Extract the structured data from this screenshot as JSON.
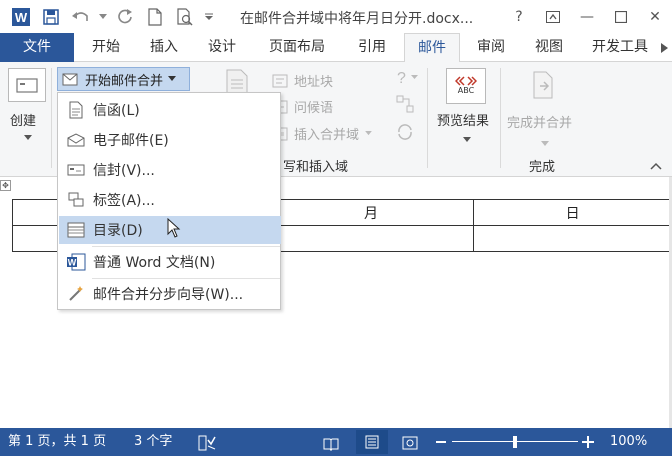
{
  "window": {
    "title": "在邮件合并域中将年月日分开.docx...",
    "help": "?",
    "minimize": "—",
    "close": "✕"
  },
  "tabs": [
    "文件",
    "开始",
    "插入",
    "设计",
    "页面布局",
    "引用",
    "邮件",
    "审阅",
    "视图",
    "开发工具"
  ],
  "ribbon": {
    "create_label": "创建",
    "start_merge_label": "开始邮件合并",
    "address_block": "地址块",
    "greeting_line": "问候语",
    "insert_merge_field": "插入合并域",
    "group_write_insert": "写和插入域",
    "preview_results": "预览结果",
    "preview_badge": "ABC",
    "finish_merge": "完成并合并",
    "group_finish": "完成"
  },
  "menu": {
    "items": [
      {
        "label": "信函(L)",
        "icon": "letter-icon"
      },
      {
        "label": "电子邮件(E)",
        "icon": "email-icon"
      },
      {
        "label": "信封(V)...",
        "icon": "envelope-icon"
      },
      {
        "label": "标签(A)...",
        "icon": "label-icon"
      },
      {
        "label": "目录(D)",
        "icon": "directory-icon"
      },
      {
        "label": "普通 Word 文档(N)",
        "icon": "word-doc-icon"
      },
      {
        "label": "邮件合并分步向导(W)...",
        "icon": "wizard-icon"
      }
    ]
  },
  "document": {
    "col_month": "月",
    "col_day": "日"
  },
  "status": {
    "page": "第 1 页，共 1 页",
    "words": "3 个字",
    "zoom": "100%",
    "zoom_level_percent": 100
  },
  "colors": {
    "accent": "#2b579a",
    "highlight": "#c5d8ef"
  }
}
